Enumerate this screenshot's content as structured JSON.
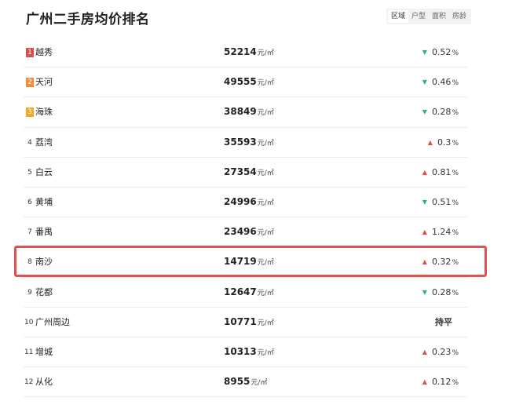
{
  "title": "广州二手房均价排名",
  "tabs": [
    {
      "label": "区域",
      "active": true
    },
    {
      "label": "户型",
      "active": false
    },
    {
      "label": "面积",
      "active": false
    },
    {
      "label": "房龄",
      "active": false
    }
  ],
  "unit": "元/㎡",
  "percent_sign": "%",
  "rows": [
    {
      "rank": "1",
      "district": "越秀",
      "price": "52214",
      "trend": "down",
      "change": "0.52"
    },
    {
      "rank": "2",
      "district": "天河",
      "price": "49555",
      "trend": "down",
      "change": "0.46"
    },
    {
      "rank": "3",
      "district": "海珠",
      "price": "38849",
      "trend": "down",
      "change": "0.28"
    },
    {
      "rank": "4",
      "district": "荔湾",
      "price": "35593",
      "trend": "up",
      "change": "0.3"
    },
    {
      "rank": "5",
      "district": "白云",
      "price": "27354",
      "trend": "up",
      "change": "0.81"
    },
    {
      "rank": "6",
      "district": "黄埔",
      "price": "24996",
      "trend": "down",
      "change": "0.51"
    },
    {
      "rank": "7",
      "district": "番禺",
      "price": "23496",
      "trend": "up",
      "change": "1.24"
    },
    {
      "rank": "8",
      "district": "南沙",
      "price": "14719",
      "trend": "up",
      "change": "0.32",
      "highlighted": true
    },
    {
      "rank": "9",
      "district": "花都",
      "price": "12647",
      "trend": "down",
      "change": "0.28"
    },
    {
      "rank": "10",
      "district": "广州周边",
      "price": "10771",
      "trend": "flat",
      "change": "持平"
    },
    {
      "rank": "11",
      "district": "增城",
      "price": "10313",
      "trend": "up",
      "change": "0.23"
    },
    {
      "rank": "12",
      "district": "从化",
      "price": "8955",
      "trend": "up",
      "change": "0.12"
    }
  ],
  "colors": {
    "down": "#2bb673",
    "up": "#e14b4b",
    "rank1": "#e14b4b",
    "rank2": "#f58a3a",
    "rank3": "#f5a623",
    "highlight_border": "#e05252"
  },
  "icons": {
    "down": "triangle-down-icon",
    "up": "triangle-up-icon"
  }
}
